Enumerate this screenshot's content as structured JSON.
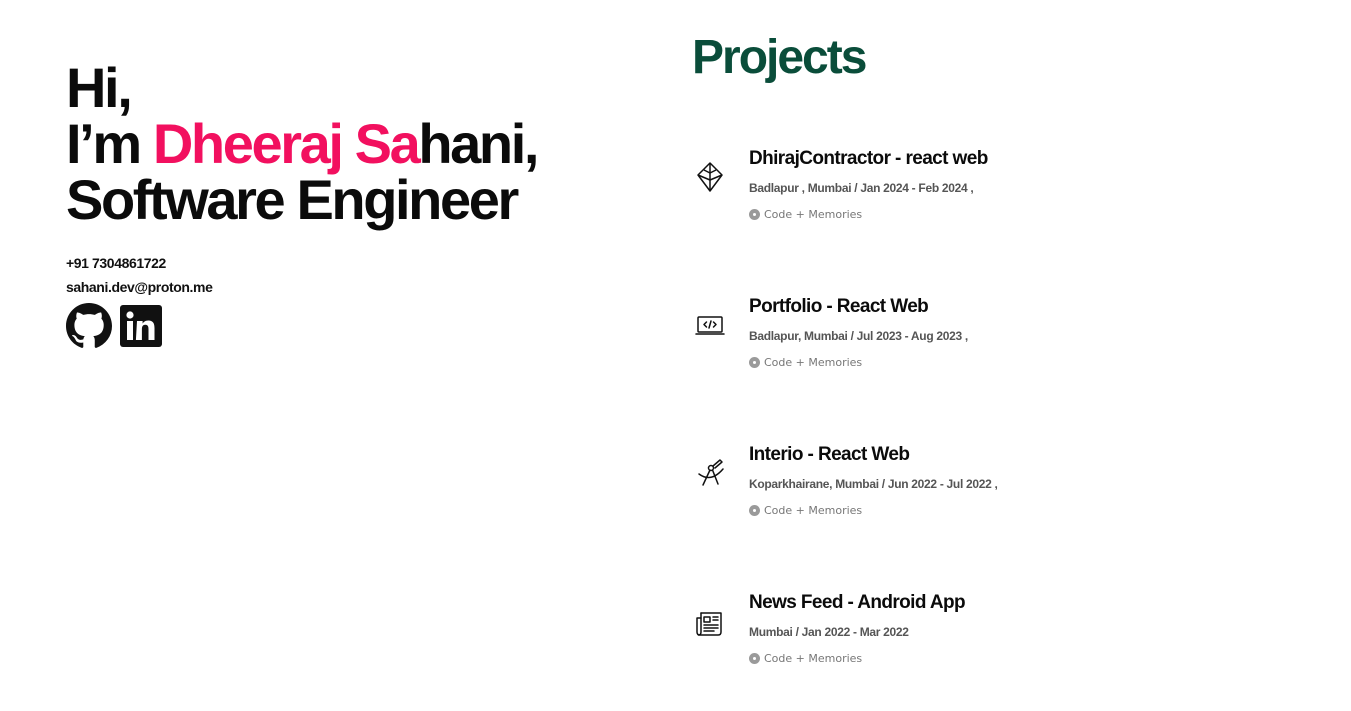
{
  "hero": {
    "line1": "Hi,",
    "line2_prefix": "I’m ",
    "name_highlight": "Dheeraj Sa",
    "line2_suffix": "hani,",
    "line3": "Software Engineer"
  },
  "contact": {
    "phone": "+91 7304861722",
    "email": "sahani.dev@proton.me"
  },
  "socials": [
    {
      "icon": "github-icon"
    },
    {
      "icon": "linkedin-icon"
    }
  ],
  "colors": {
    "accent": "#f2105f",
    "heading": "#0a4d3a",
    "text": "#0b0b0b",
    "meta": "#555555"
  },
  "projects_section": {
    "title": "Projects",
    "items": [
      {
        "icon": "ethereum-icon",
        "title": "DhirajContractor - react web",
        "meta": "Badlapur , Mumbai / Jan 2024 - Feb 2024 ,",
        "link": "Code + Memories"
      },
      {
        "icon": "laptop-code-icon",
        "title": "Portfolio - React Web",
        "meta": "Badlapur, Mumbai / Jul 2023 - Aug 2023 ,",
        "link": "Code + Memories"
      },
      {
        "icon": "compass-drawing-icon",
        "title": "Interio - React Web",
        "meta": "Koparkhairane, Mumbai / Jun 2022 - Jul 2022 ,",
        "link": "Code + Memories"
      },
      {
        "icon": "newspaper-icon",
        "title": "News Feed - Android App",
        "meta": "Mumbai / Jan 2022 - Mar 2022",
        "link": "Code + Memories"
      }
    ]
  }
}
